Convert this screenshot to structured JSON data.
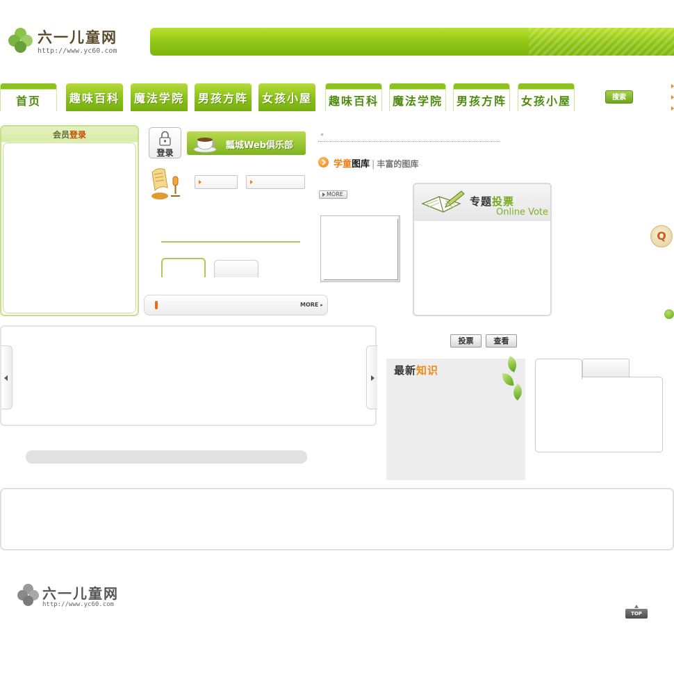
{
  "header": {
    "logo_cn": "六一儿童网",
    "logo_url": "http://www.yc60.com"
  },
  "nav": {
    "items": [
      {
        "label": "首页"
      },
      {
        "label": "趣味百科"
      },
      {
        "label": "魔法学院"
      },
      {
        "label": "男孩方阵"
      },
      {
        "label": "女孩小屋"
      },
      {
        "label": "趣味百科"
      },
      {
        "label": "魔法学院"
      },
      {
        "label": "男孩方阵"
      },
      {
        "label": "女孩小屋"
      }
    ],
    "search_label": "搜索"
  },
  "member": {
    "title_prefix": "会员",
    "title_highlight": "登录",
    "login_label": "登录",
    "club_banner": "瓢城Web俱乐部",
    "more_label": "MORE"
  },
  "gallery": {
    "title_orange": "学童",
    "title_black": "图库",
    "separator": "|",
    "subtitle": "丰富的图库",
    "more_label": "MORE"
  },
  "vote": {
    "title_prefix": "专题",
    "title_highlight": "投票",
    "title_en": "Online Vote",
    "vote_button": "投票",
    "view_button": "查看"
  },
  "knowledge": {
    "title_prefix": "最新",
    "title_highlight": "知识"
  },
  "floaters": {
    "q_label": "Q"
  },
  "footer": {
    "logo_cn": "六一儿童网",
    "logo_url": "http://www.yc60.com",
    "top_label": "TOP"
  },
  "colors": {
    "brand_green": "#8cc21c",
    "accent_orange": "#f07d14"
  }
}
